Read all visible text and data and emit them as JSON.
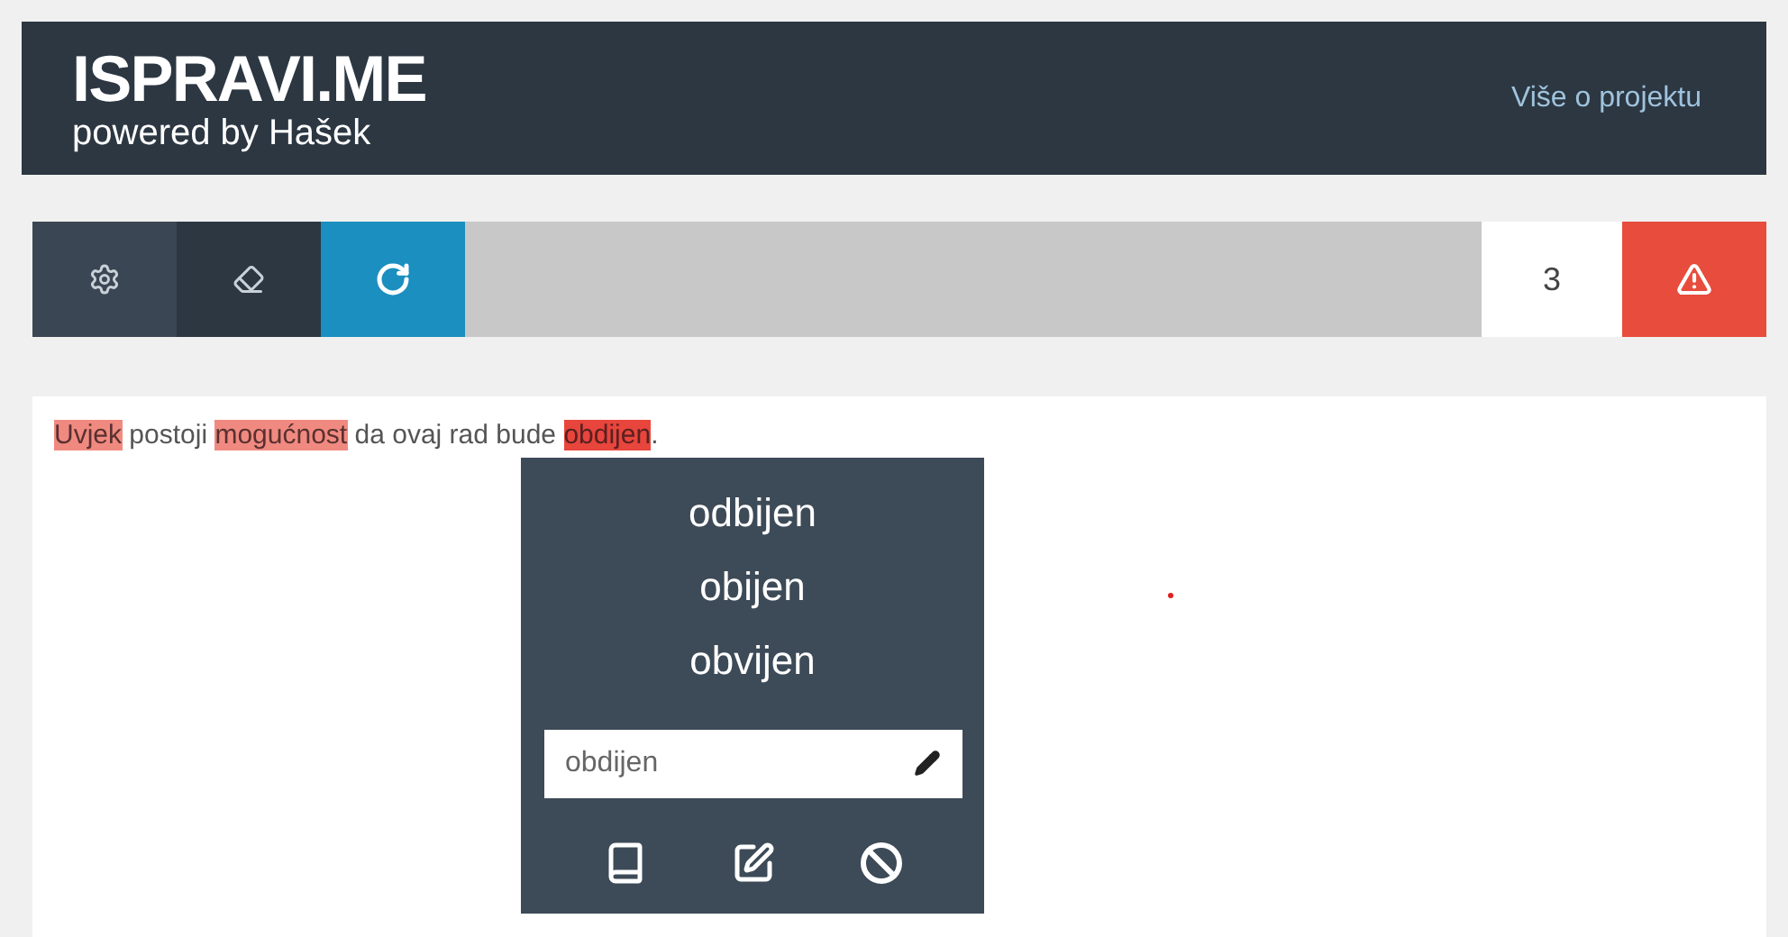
{
  "header": {
    "logo_title": "ISPRAVI.ME",
    "logo_subtitle": "powered by Hašek",
    "link": "Više o projektu"
  },
  "toolbar": {
    "error_count": "3"
  },
  "text": {
    "segments": [
      {
        "text": "Uvjek",
        "error": true,
        "selected": false
      },
      {
        "text": " postoji ",
        "error": false,
        "selected": false
      },
      {
        "text": "mogućnost",
        "error": true,
        "selected": false
      },
      {
        "text": " da ovaj rad bude ",
        "error": false,
        "selected": false
      },
      {
        "text": "obdijen",
        "error": true,
        "selected": true
      },
      {
        "text": ".",
        "error": false,
        "selected": false
      }
    ]
  },
  "popup": {
    "suggestions": [
      "odbijen",
      "obijen",
      "obvijen"
    ],
    "field_value": "obdijen"
  }
}
